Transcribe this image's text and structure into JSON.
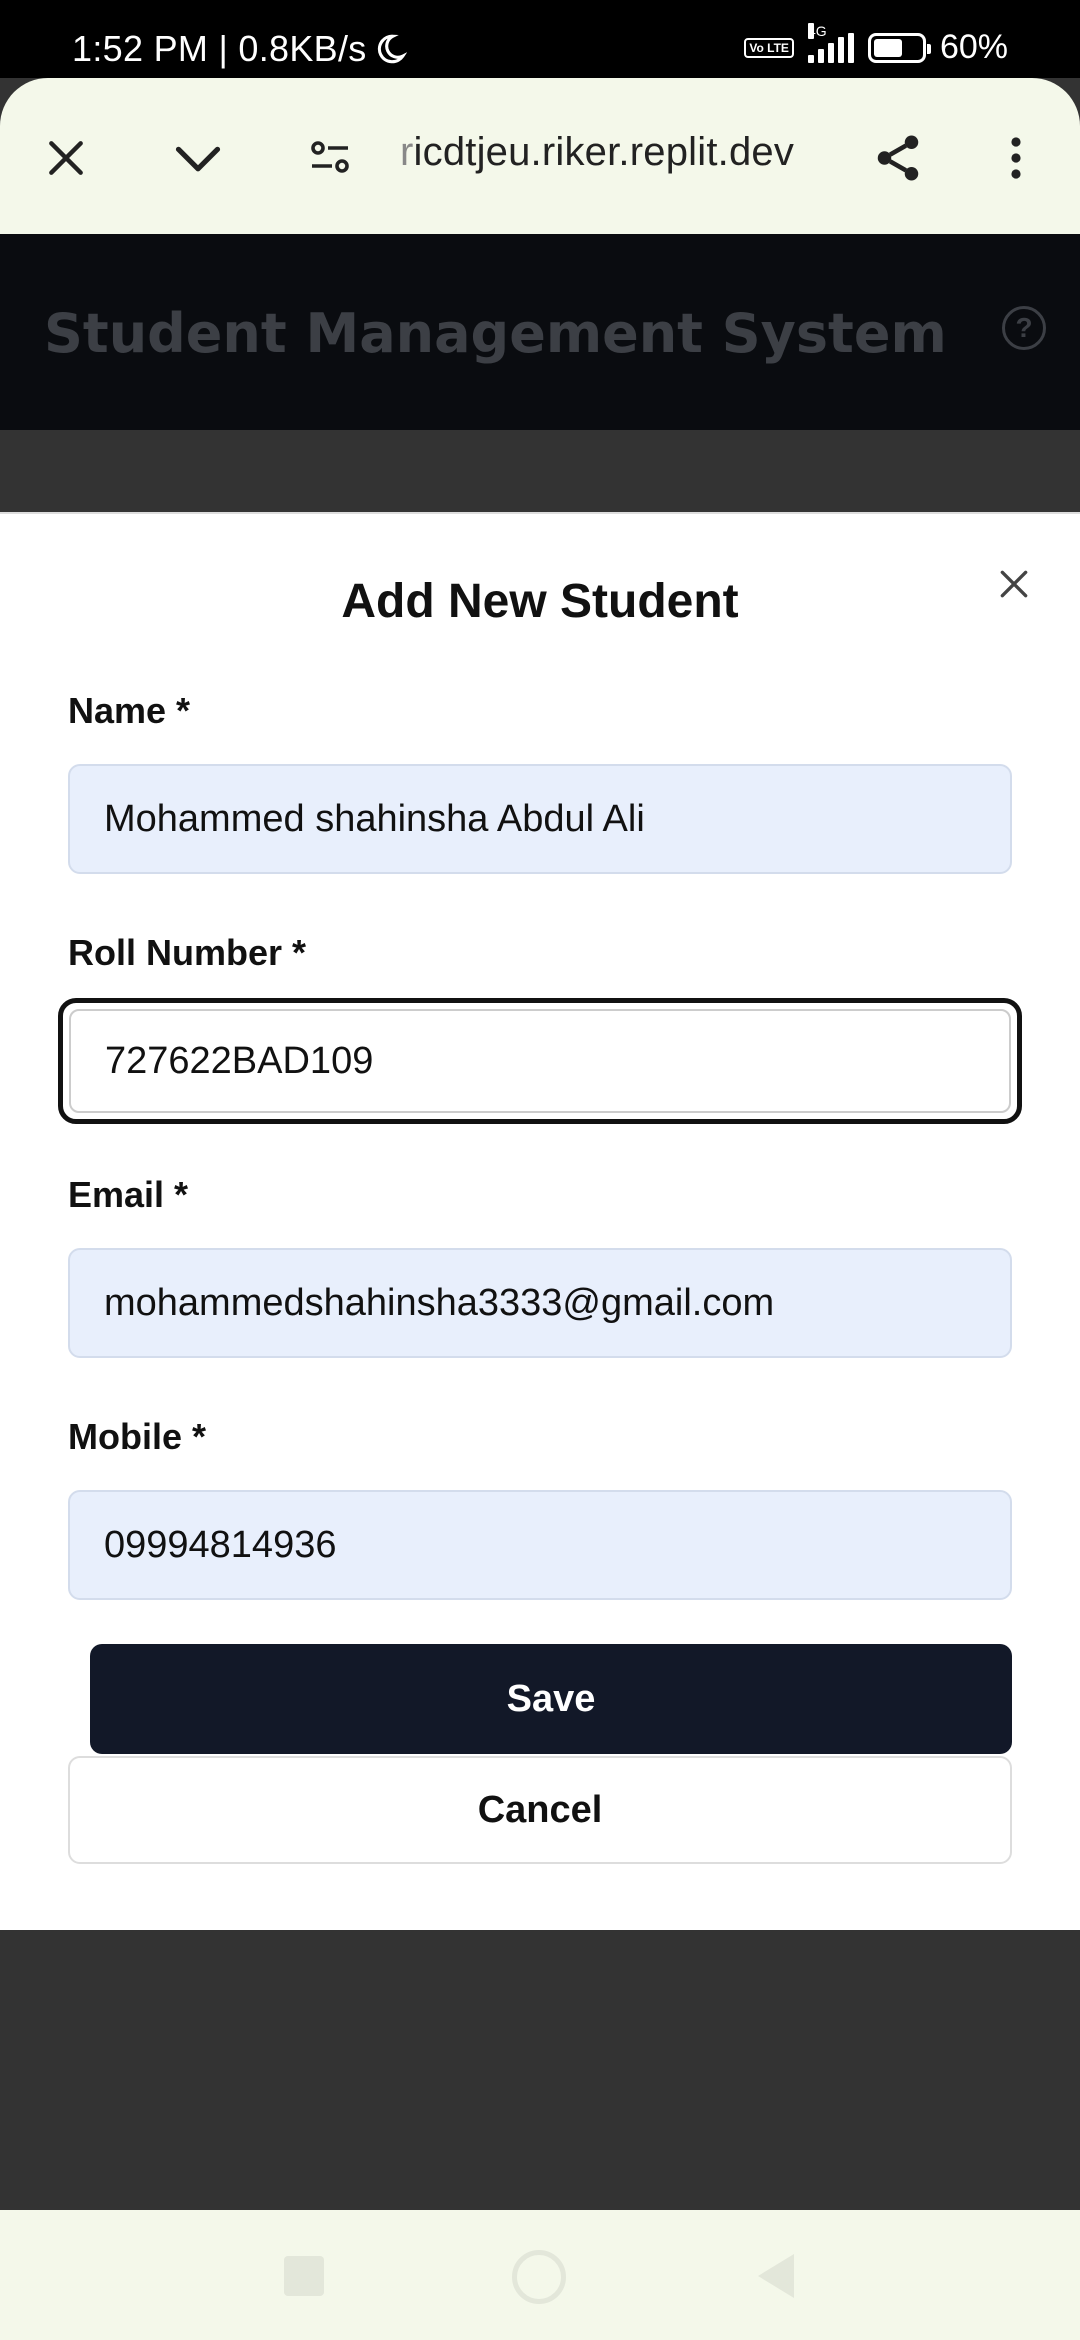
{
  "status_bar": {
    "time_and_speed": "1:52 PM | 0.8KB/s",
    "volte": "Vo LTE",
    "network": "4G",
    "battery_percent": "60%",
    "battery_level": 0.6
  },
  "browser": {
    "url_faded": "r",
    "url": "icdtjeu.riker.replit.dev",
    "icons": [
      "close-icon",
      "chevron-down-icon",
      "site-settings-icon",
      "share-icon",
      "more-vert-icon"
    ]
  },
  "app": {
    "title": "Student Management System",
    "help_icon": "?"
  },
  "modal": {
    "title": "Add New Student",
    "fields": [
      {
        "label": "Name *",
        "value": "Mohammed shahinsha Abdul Ali"
      },
      {
        "label": "Roll Number *",
        "value": "727622BAD109"
      },
      {
        "label": "Email *",
        "value": "mohammedshahinsha3333@gmail.com"
      },
      {
        "label": "Mobile *",
        "value": "09994814936"
      }
    ],
    "save_label": "Save",
    "cancel_label": "Cancel"
  },
  "colors": {
    "primary_button": "#121828",
    "input_bg": "#e8effc",
    "browser_bar": "#f4f8ea"
  }
}
